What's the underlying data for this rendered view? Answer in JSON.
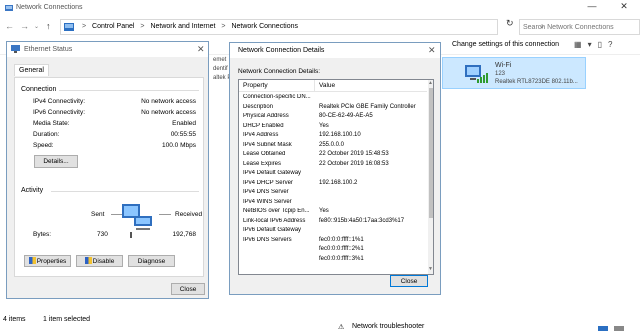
{
  "window": {
    "title": "Network Connections",
    "min": "—",
    "close": "✕"
  },
  "address": {
    "crumbs": [
      "Control Panel",
      "Network and Internet",
      "Network Connections"
    ],
    "sep": ">",
    "search_placeholder": "Search Network Connections"
  },
  "nav": {
    "back": "←",
    "forward": "→",
    "up": "↑",
    "dropdown": "⌄",
    "refresh": "↻"
  },
  "cmdbar": {
    "change_settings": "Change settings of this connection",
    "view_icons": [
      "▦",
      "▾",
      "▯",
      "?"
    ]
  },
  "background": {
    "lines": [
      "emet",
      "dentif",
      "altek P"
    ]
  },
  "wifi": {
    "name": "Wi-Fi",
    "ssid": "123",
    "adapter": "Realtek RTL8723DE 802.11b..."
  },
  "statusbar": {
    "count": "4 items",
    "selected": "1 item selected",
    "troubleshooter": "Network troubleshooter"
  },
  "ethernet_status": {
    "title": "Ethernet Status",
    "close": "✕",
    "tab": "General",
    "connection_heading": "Connection",
    "rows": [
      {
        "label": "IPv4 Connectivity:",
        "value": "No network access"
      },
      {
        "label": "IPv6 Connectivity:",
        "value": "No network access"
      },
      {
        "label": "Media State:",
        "value": "Enabled"
      },
      {
        "label": "Duration:",
        "value": "00:55:55"
      },
      {
        "label": "Speed:",
        "value": "100.0 Mbps"
      }
    ],
    "details_button": "Details...",
    "activity_heading": "Activity",
    "sent_label": "Sent",
    "received_label": "Received",
    "bytes_label": "Bytes:",
    "bytes_sent": "730",
    "bytes_received": "192,768",
    "properties_button": "Properties",
    "disable_button": "Disable",
    "diagnose_button": "Diagnose",
    "close_button": "Close"
  },
  "details": {
    "title": "Network Connection Details",
    "close": "✕",
    "caption": "Network Connection Details:",
    "col_property": "Property",
    "col_value": "Value",
    "rows": [
      {
        "p": "Connection-specific DN...",
        "v": ""
      },
      {
        "p": "Description",
        "v": "Realtek PCIe GBE Family Controller"
      },
      {
        "p": "Physical Address",
        "v": "80-CE-62-49-AE-A5"
      },
      {
        "p": "DHCP Enabled",
        "v": "Yes"
      },
      {
        "p": "IPv4 Address",
        "v": "192.168.100.10"
      },
      {
        "p": "IPv4 Subnet Mask",
        "v": "255.0.0.0"
      },
      {
        "p": "Lease Obtained",
        "v": "22 October 2019 15:48:53"
      },
      {
        "p": "Lease Expires",
        "v": "22 October 2019 16:08:53"
      },
      {
        "p": "IPv4 Default Gateway",
        "v": ""
      },
      {
        "p": "IPv4 DHCP Server",
        "v": "192.168.100.2"
      },
      {
        "p": "IPv4 DNS Server",
        "v": ""
      },
      {
        "p": "IPv4 WINS Server",
        "v": ""
      },
      {
        "p": "NetBIOS over Tcpip En...",
        "v": "Yes"
      },
      {
        "p": "Link-local IPv6 Address",
        "v": "fe80::915b:4a50:17aa:3cd3%17"
      },
      {
        "p": "IPv6 Default Gateway",
        "v": ""
      },
      {
        "p": "IPv6 DNS Servers",
        "v": "fec0:0:0:ffff::1%1"
      },
      {
        "p": "",
        "v": "fec0:0:0:ffff::2%1"
      },
      {
        "p": "",
        "v": "fec0:0:0:ffff::3%1"
      }
    ],
    "close_button": "Close"
  }
}
